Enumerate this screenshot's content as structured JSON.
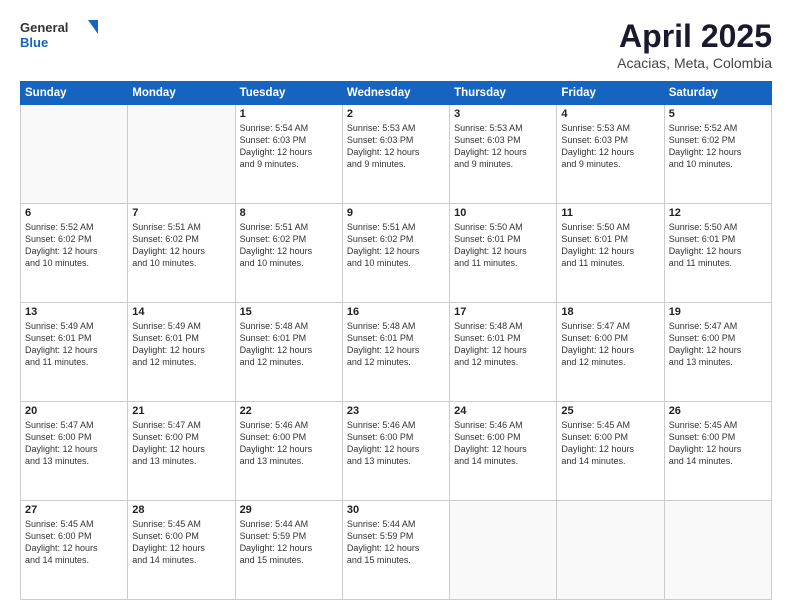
{
  "logo": {
    "general": "General",
    "blue": "Blue"
  },
  "header": {
    "month_year": "April 2025",
    "location": "Acacias, Meta, Colombia"
  },
  "days_of_week": [
    "Sunday",
    "Monday",
    "Tuesday",
    "Wednesday",
    "Thursday",
    "Friday",
    "Saturday"
  ],
  "weeks": [
    [
      {
        "day": "",
        "info": ""
      },
      {
        "day": "",
        "info": ""
      },
      {
        "day": "1",
        "info": "Sunrise: 5:54 AM\nSunset: 6:03 PM\nDaylight: 12 hours\nand 9 minutes."
      },
      {
        "day": "2",
        "info": "Sunrise: 5:53 AM\nSunset: 6:03 PM\nDaylight: 12 hours\nand 9 minutes."
      },
      {
        "day": "3",
        "info": "Sunrise: 5:53 AM\nSunset: 6:03 PM\nDaylight: 12 hours\nand 9 minutes."
      },
      {
        "day": "4",
        "info": "Sunrise: 5:53 AM\nSunset: 6:03 PM\nDaylight: 12 hours\nand 9 minutes."
      },
      {
        "day": "5",
        "info": "Sunrise: 5:52 AM\nSunset: 6:02 PM\nDaylight: 12 hours\nand 10 minutes."
      }
    ],
    [
      {
        "day": "6",
        "info": "Sunrise: 5:52 AM\nSunset: 6:02 PM\nDaylight: 12 hours\nand 10 minutes."
      },
      {
        "day": "7",
        "info": "Sunrise: 5:51 AM\nSunset: 6:02 PM\nDaylight: 12 hours\nand 10 minutes."
      },
      {
        "day": "8",
        "info": "Sunrise: 5:51 AM\nSunset: 6:02 PM\nDaylight: 12 hours\nand 10 minutes."
      },
      {
        "day": "9",
        "info": "Sunrise: 5:51 AM\nSunset: 6:02 PM\nDaylight: 12 hours\nand 10 minutes."
      },
      {
        "day": "10",
        "info": "Sunrise: 5:50 AM\nSunset: 6:01 PM\nDaylight: 12 hours\nand 11 minutes."
      },
      {
        "day": "11",
        "info": "Sunrise: 5:50 AM\nSunset: 6:01 PM\nDaylight: 12 hours\nand 11 minutes."
      },
      {
        "day": "12",
        "info": "Sunrise: 5:50 AM\nSunset: 6:01 PM\nDaylight: 12 hours\nand 11 minutes."
      }
    ],
    [
      {
        "day": "13",
        "info": "Sunrise: 5:49 AM\nSunset: 6:01 PM\nDaylight: 12 hours\nand 11 minutes."
      },
      {
        "day": "14",
        "info": "Sunrise: 5:49 AM\nSunset: 6:01 PM\nDaylight: 12 hours\nand 12 minutes."
      },
      {
        "day": "15",
        "info": "Sunrise: 5:48 AM\nSunset: 6:01 PM\nDaylight: 12 hours\nand 12 minutes."
      },
      {
        "day": "16",
        "info": "Sunrise: 5:48 AM\nSunset: 6:01 PM\nDaylight: 12 hours\nand 12 minutes."
      },
      {
        "day": "17",
        "info": "Sunrise: 5:48 AM\nSunset: 6:01 PM\nDaylight: 12 hours\nand 12 minutes."
      },
      {
        "day": "18",
        "info": "Sunrise: 5:47 AM\nSunset: 6:00 PM\nDaylight: 12 hours\nand 12 minutes."
      },
      {
        "day": "19",
        "info": "Sunrise: 5:47 AM\nSunset: 6:00 PM\nDaylight: 12 hours\nand 13 minutes."
      }
    ],
    [
      {
        "day": "20",
        "info": "Sunrise: 5:47 AM\nSunset: 6:00 PM\nDaylight: 12 hours\nand 13 minutes."
      },
      {
        "day": "21",
        "info": "Sunrise: 5:47 AM\nSunset: 6:00 PM\nDaylight: 12 hours\nand 13 minutes."
      },
      {
        "day": "22",
        "info": "Sunrise: 5:46 AM\nSunset: 6:00 PM\nDaylight: 12 hours\nand 13 minutes."
      },
      {
        "day": "23",
        "info": "Sunrise: 5:46 AM\nSunset: 6:00 PM\nDaylight: 12 hours\nand 13 minutes."
      },
      {
        "day": "24",
        "info": "Sunrise: 5:46 AM\nSunset: 6:00 PM\nDaylight: 12 hours\nand 14 minutes."
      },
      {
        "day": "25",
        "info": "Sunrise: 5:45 AM\nSunset: 6:00 PM\nDaylight: 12 hours\nand 14 minutes."
      },
      {
        "day": "26",
        "info": "Sunrise: 5:45 AM\nSunset: 6:00 PM\nDaylight: 12 hours\nand 14 minutes."
      }
    ],
    [
      {
        "day": "27",
        "info": "Sunrise: 5:45 AM\nSunset: 6:00 PM\nDaylight: 12 hours\nand 14 minutes."
      },
      {
        "day": "28",
        "info": "Sunrise: 5:45 AM\nSunset: 6:00 PM\nDaylight: 12 hours\nand 14 minutes."
      },
      {
        "day": "29",
        "info": "Sunrise: 5:44 AM\nSunset: 5:59 PM\nDaylight: 12 hours\nand 15 minutes."
      },
      {
        "day": "30",
        "info": "Sunrise: 5:44 AM\nSunset: 5:59 PM\nDaylight: 12 hours\nand 15 minutes."
      },
      {
        "day": "",
        "info": ""
      },
      {
        "day": "",
        "info": ""
      },
      {
        "day": "",
        "info": ""
      }
    ]
  ]
}
